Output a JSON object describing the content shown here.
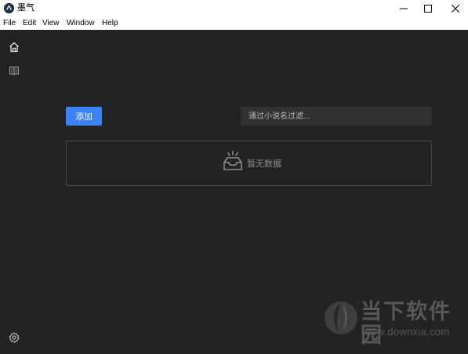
{
  "window": {
    "title": "墨气",
    "controls": {
      "minimize_icon": "minimize-icon",
      "maximize_icon": "maximize-icon",
      "close_icon": "close-icon"
    }
  },
  "menu": {
    "items": [
      "File",
      "Edit",
      "View",
      "Window",
      "Help"
    ]
  },
  "sidebar": {
    "items": [
      {
        "icon": "home-icon"
      },
      {
        "icon": "book-icon"
      }
    ],
    "bottom_icon": "settings-icon"
  },
  "main": {
    "add_label": "添加",
    "search": {
      "placeholder": "通过小说名过滤...",
      "value": ""
    },
    "empty": {
      "text": "暂无数据",
      "icon": "empty-inbox-icon"
    }
  },
  "watermark": {
    "brand": "当下软件园",
    "url": "www.downxia.com"
  },
  "colors": {
    "background": "#232325",
    "accent": "#3b82f6",
    "input_bg": "#323234"
  }
}
